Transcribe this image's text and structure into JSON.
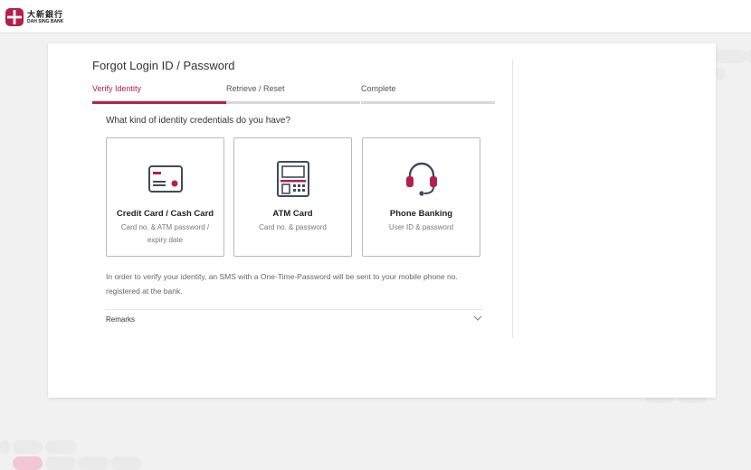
{
  "brand": {
    "name_cn": "大新銀行",
    "name_en": "DAH SING BANK"
  },
  "page": {
    "title": "Forgot Login ID / Password"
  },
  "steps": [
    {
      "label": "Verify Identity",
      "active": true
    },
    {
      "label": "Retrieve / Reset",
      "active": false
    },
    {
      "label": "Complete",
      "active": false
    }
  ],
  "question": "What kind of identity credentials do you have?",
  "options": [
    {
      "title": "Credit Card / Cash Card",
      "subtitle": "Card no. & ATM password / expiry date",
      "icon": "credit-card-icon"
    },
    {
      "title": "ATM Card",
      "subtitle": "Card no. & password",
      "icon": "atm-machine-icon"
    },
    {
      "title": "Phone Banking",
      "subtitle": "User ID & password",
      "icon": "headset-icon"
    }
  ],
  "info_text": "In order to verify your identity, an SMS with a One-Time-Password will be sent to your mobile phone no. registered at the bank.",
  "remarks_label": "Remarks",
  "colors": {
    "accent": "#b3204c",
    "background": "#f1f1f1",
    "card": "#ffffff",
    "decor_pink": "#f3c6d5",
    "decor_grey": "#eaeaea"
  }
}
